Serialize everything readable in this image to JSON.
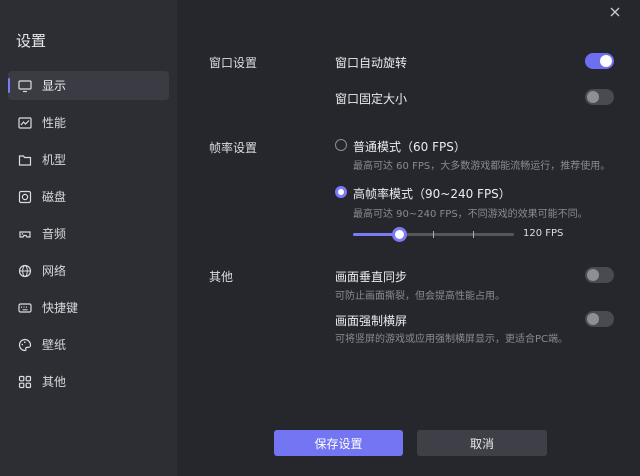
{
  "colors": {
    "accent": "#7b7cf5",
    "sidebar_bg": "#2d2e34",
    "main_bg": "#26272d"
  },
  "sidebar": {
    "title": "设置",
    "items": [
      {
        "label": "显示",
        "icon": "monitor-icon",
        "active": true
      },
      {
        "label": "性能",
        "icon": "performance-icon"
      },
      {
        "label": "机型",
        "icon": "device-model-icon"
      },
      {
        "label": "磁盘",
        "icon": "disk-icon"
      },
      {
        "label": "音频",
        "icon": "audio-icon"
      },
      {
        "label": "网络",
        "icon": "globe-icon"
      },
      {
        "label": "快捷键",
        "icon": "keyboard-icon"
      },
      {
        "label": "壁纸",
        "icon": "palette-icon"
      },
      {
        "label": "其他",
        "icon": "grid-icon"
      }
    ]
  },
  "window_settings": {
    "label": "窗口设置",
    "auto_rotate": {
      "label": "窗口自动旋转",
      "on": true
    },
    "fixed_size": {
      "label": "窗口固定大小",
      "on": false
    }
  },
  "frame_rate": {
    "label": "帧率设置",
    "normal": {
      "label": "普通模式（60 FPS）",
      "desc": "最高可达 60 FPS，大多数游戏都能流畅运行，推荐使用。",
      "checked": false
    },
    "high": {
      "label": "高帧率模式（90~240 FPS）",
      "desc": "最高可达 90~240 FPS，不同游戏的效果可能不同。",
      "checked": true
    },
    "slider": {
      "min": 90,
      "max": 240,
      "value": 120,
      "value_label": "120 FPS"
    }
  },
  "other": {
    "label": "其他",
    "vsync": {
      "label": "画面垂直同步",
      "desc": "可防止画面撕裂，但会提高性能占用。",
      "on": false
    },
    "force_landscape": {
      "label": "画面强制横屏",
      "desc": "可将竖屏的游戏或应用强制横屏显示，更适合PC端。",
      "on": false
    }
  },
  "footer": {
    "save": "保存设置",
    "cancel": "取消"
  }
}
